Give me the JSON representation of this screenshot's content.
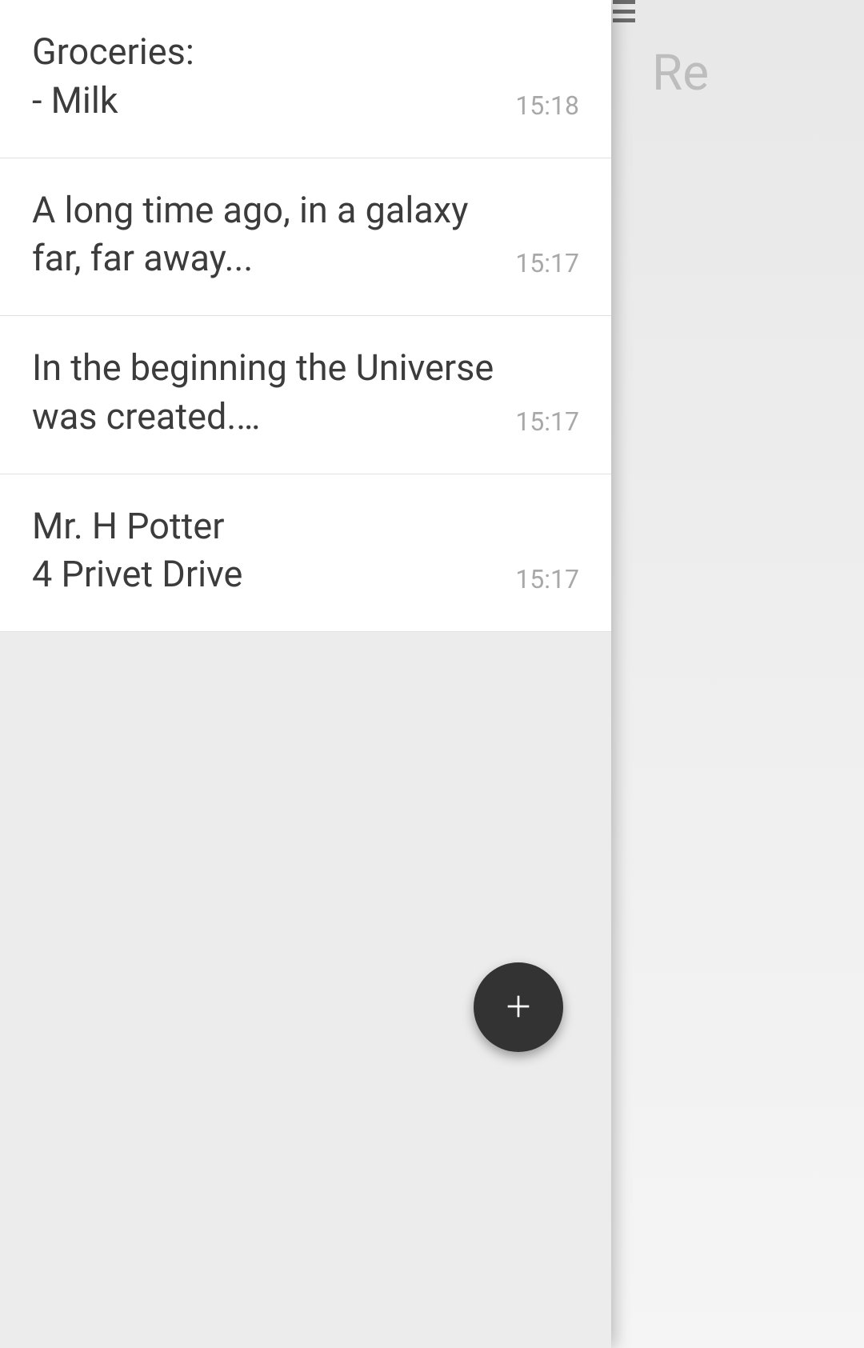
{
  "background": {
    "title_fragment": "Re"
  },
  "notes": [
    {
      "preview": "Groceries:\n- Milk",
      "time": "15:18"
    },
    {
      "preview": "A long time ago, in a galaxy far, far away...",
      "time": "15:17"
    },
    {
      "preview": "In the beginning the Universe was created.…",
      "time": "15:17"
    },
    {
      "preview": "Mr. H Potter\n4 Privet Drive",
      "time": "15:17"
    }
  ],
  "fab": {
    "label": "Add note"
  }
}
